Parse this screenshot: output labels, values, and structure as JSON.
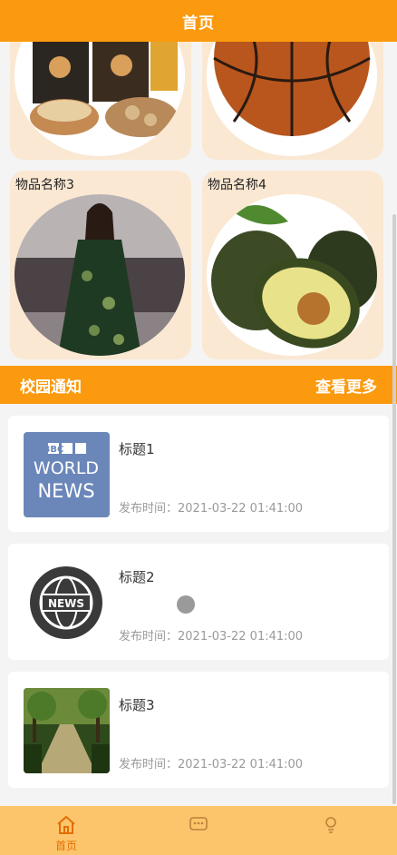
{
  "header": {
    "title": "首页"
  },
  "goods": [
    {
      "name": "",
      "image": "snack-bag-photo"
    },
    {
      "name": "",
      "image": "basketball-photo"
    },
    {
      "name": "物品名称3",
      "image": "floral-dress-photo"
    },
    {
      "name": "物品名称4",
      "image": "avocado-photo"
    }
  ],
  "notice": {
    "title": "校园通知",
    "more": "查看更多"
  },
  "news": [
    {
      "title": "标题1",
      "time": "发布时间：2021-03-22 01:41:00",
      "thumb": "bbc-world-news-logo",
      "logo_lines": [
        "BBC",
        "WORLD",
        "NEWS"
      ]
    },
    {
      "title": "标题2",
      "time": "发布时间：2021-03-22 01:41:00",
      "thumb": "globe-news-icon",
      "logo_lines": [
        "NEWS"
      ]
    },
    {
      "title": "标题3",
      "time": "发布时间：2021-03-22 01:41:00",
      "thumb": "tree-lined-road-photo"
    }
  ],
  "tabbar": {
    "items": [
      {
        "label": "首页",
        "icon": "home-icon",
        "active": true
      },
      {
        "label": "",
        "icon": "chat-icon",
        "active": false
      },
      {
        "label": "",
        "icon": "user-icon",
        "active": false
      }
    ]
  },
  "colors": {
    "primary": "#fb9a0e",
    "card_bg": "#fbe8d2",
    "tabbar_bg": "#fdc56b",
    "active_tab": "#e26f05"
  }
}
